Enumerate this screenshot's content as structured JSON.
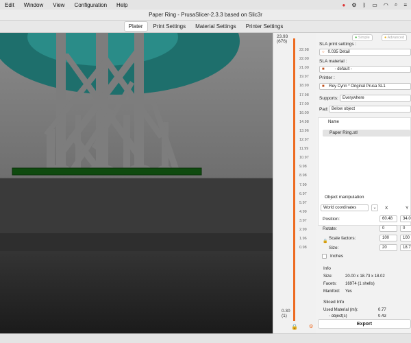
{
  "menubar": {
    "items": [
      "Edit",
      "Window",
      "View",
      "Configuration",
      "Help"
    ]
  },
  "window": {
    "title": "Paper Ring - PrusaSlicer-2.3.3 based on Slic3r"
  },
  "tabs": [
    "Plater",
    "Print Settings",
    "Material Settings",
    "Printer Settings"
  ],
  "slider": {
    "top_value": "23.93",
    "top_layer": "(676)",
    "bottom_value": "0.30",
    "bottom_layer": "(1)",
    "ticks": [
      "22.98",
      "22.00",
      "21.00",
      "19.97",
      "18.99",
      "17.98",
      "17.00",
      "16.00",
      "14.98",
      "13.96",
      "12.97",
      "11.99",
      "10.97",
      "9.98",
      "8.98",
      "7.99",
      "6.97",
      "5.97",
      "4.99",
      "3.97",
      "2.99",
      "1.96",
      "0.98"
    ]
  },
  "sidebar": {
    "mode_simple": "Simple",
    "mode_advanced": "Advanced",
    "print_settings_label": "SLA print settings :",
    "print_settings_value": "0.035 Detail",
    "material_label": "SLA material :",
    "material_value": "- default -",
    "printer_label": "Printer :",
    "printer_value": "Rey Cynn * Original Prusa SL1",
    "supports_label": "Supports:",
    "supports_value": "Everywhere",
    "pad_label": "Pad:",
    "pad_value": "Below object",
    "list_header": "Name",
    "list_item": "Paper Ring.stl",
    "object_manipulation": "Object manipulation",
    "coord_system": "World coordinates",
    "axis_x": "X",
    "axis_y": "Y",
    "position_label": "Position:",
    "position_x": "60.48",
    "position_y": "34.0",
    "rotate_label": "Rotate:",
    "rotate_x": "0",
    "rotate_y": "0",
    "scale_label": "Scale factors:",
    "scale_x": "100",
    "scale_y": "100",
    "size_label": "Size:",
    "size_x": "20",
    "size_y": "18.7",
    "inches_label": "Inches",
    "info_title": "Info",
    "info_size_label": "Size:",
    "info_size_value": "20.00 x 18.73 x 18.02",
    "info_facets_label": "Facets:",
    "info_facets_value": "16974 (1 shells)",
    "info_manifold_label": "Manifold:",
    "info_manifold_value": "Yes",
    "sliced_title": "Sliced Info",
    "used_material_label": "Used Material (ml):",
    "used_material_value": "0.77",
    "object_label": "- object(s)",
    "object_value": "0.43",
    "export_label": "Export"
  },
  "colors": {
    "accent": "#ed6b21",
    "dish": "#1e6f6c",
    "support": "#808080",
    "pad": "#0f4a0f"
  }
}
